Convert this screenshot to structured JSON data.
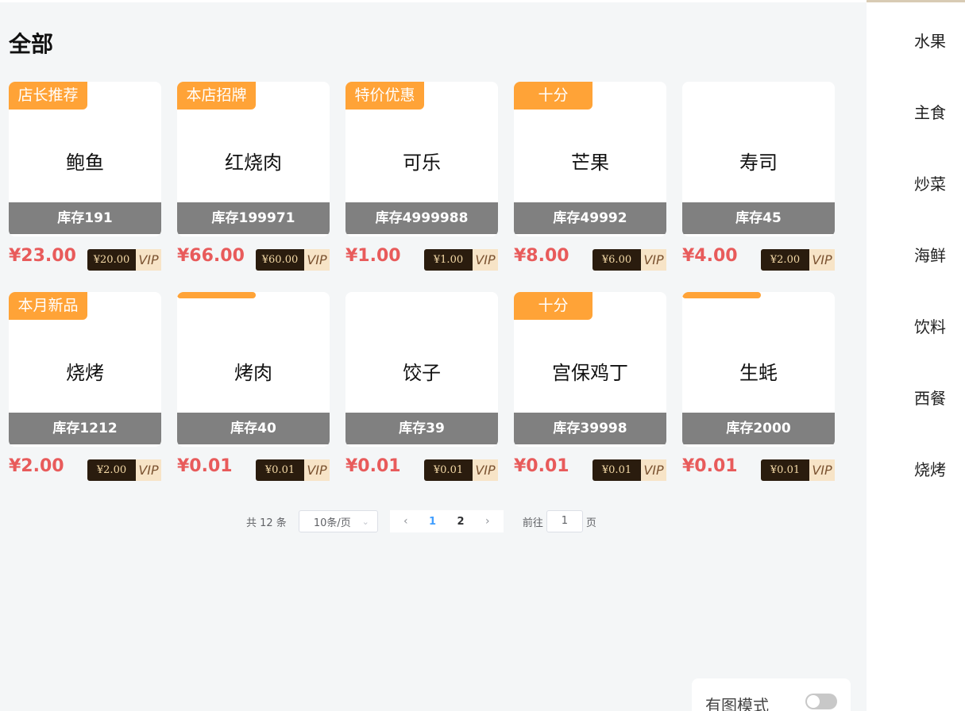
{
  "main": {
    "title": "全部",
    "products": [
      {
        "tag": "店长推荐",
        "name": "鲍鱼",
        "stock": "库存191",
        "price": "¥23.00",
        "vip_price": "¥20.00",
        "vip_label": "VIP"
      },
      {
        "tag": "本店招牌",
        "name": "红烧肉",
        "stock": "库存199971",
        "price": "¥66.00",
        "vip_price": "¥60.00",
        "vip_label": "VIP"
      },
      {
        "tag": "特价优惠",
        "name": "可乐",
        "stock": "库存4999988",
        "price": "¥1.00",
        "vip_price": "¥1.00",
        "vip_label": "VIP"
      },
      {
        "tag": "十分",
        "name": "芒果",
        "stock": "库存49992",
        "price": "¥8.00",
        "vip_price": "¥6.00",
        "vip_label": "VIP"
      },
      {
        "tag": "",
        "name": "寿司",
        "stock": "库存45",
        "price": "¥4.00",
        "vip_price": "¥2.00",
        "vip_label": "VIP"
      },
      {
        "tag": "本月新品",
        "name": "烧烤",
        "stock": "库存1212",
        "price": "¥2.00",
        "vip_price": "¥2.00",
        "vip_label": "VIP"
      },
      {
        "tag": "",
        "name": "烤肉",
        "stock": "库存40",
        "price": "¥0.01",
        "vip_price": "¥0.01",
        "vip_label": "VIP"
      },
      {
        "tag": "",
        "name": "饺子",
        "stock": "库存39",
        "price": "¥0.01",
        "vip_price": "¥0.01",
        "vip_label": "VIP"
      },
      {
        "tag": "十分",
        "name": "宫保鸡丁",
        "stock": "库存39998",
        "price": "¥0.01",
        "vip_price": "¥0.01",
        "vip_label": "VIP"
      },
      {
        "tag": "",
        "name": "生蚝",
        "stock": "库存2000",
        "price": "¥0.01",
        "vip_price": "¥0.01",
        "vip_label": "VIP"
      }
    ]
  },
  "pagination": {
    "total": "共 12 条",
    "page_size": "10条/页",
    "pages": [
      "1",
      "2"
    ],
    "current_page": "1",
    "goto_prefix": "前往",
    "goto_value": "1",
    "goto_suffix": "页"
  },
  "image_mode": {
    "label": "有图模式",
    "enabled": false
  },
  "sidebar": {
    "items": [
      "水果",
      "主食",
      "炒菜",
      "海鲜",
      "饮料",
      "西餐",
      "烧烤"
    ]
  },
  "colors": {
    "tag": "#ffa337",
    "price": "#e85b5b",
    "stock_bar": "#808080",
    "active_page": "#409eff"
  }
}
